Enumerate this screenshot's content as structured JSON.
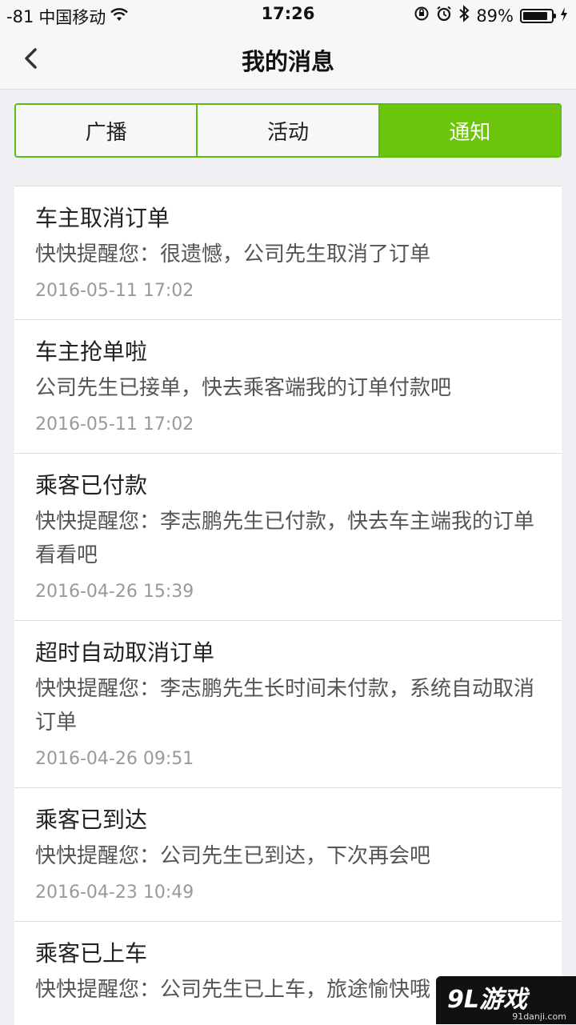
{
  "status_bar": {
    "signal": "-81",
    "carrier": "中国移动",
    "time": "17:26",
    "battery_percent": "89%",
    "battery_level": 0.89
  },
  "nav": {
    "title": "我的消息",
    "back_icon": "chevron-left-icon"
  },
  "tabs": [
    {
      "label": "广播",
      "active": false
    },
    {
      "label": "活动",
      "active": false
    },
    {
      "label": "通知",
      "active": true
    }
  ],
  "colors": {
    "accent": "#6cc40b",
    "tab_border": "#5bbf10",
    "time_text": "#999999"
  },
  "messages": [
    {
      "title": "车主取消订单",
      "body": "快快提醒您：很遗憾，公司先生取消了订单",
      "time": "2016-05-11 17:02"
    },
    {
      "title": "车主抢单啦",
      "body": "公司先生已接单，快去乘客端我的订单付款吧",
      "time": "2016-05-11 17:02"
    },
    {
      "title": "乘客已付款",
      "body": "快快提醒您：李志鹏先生已付款，快去车主端我的订单看看吧",
      "time": "2016-04-26 15:39"
    },
    {
      "title": "超时自动取消订单",
      "body": "快快提醒您：李志鹏先生长时间未付款，系统自动取消订单",
      "time": "2016-04-26 09:51"
    },
    {
      "title": "乘客已到达",
      "body": "快快提醒您：公司先生已到达，下次再会吧",
      "time": "2016-04-23 10:49"
    },
    {
      "title": "乘客已上车",
      "body": "快快提醒您：公司先生已上车，旅途愉快哦",
      "time": ""
    }
  ],
  "watermark": {
    "logo": "9L游戏",
    "site": "91danji.com"
  }
}
